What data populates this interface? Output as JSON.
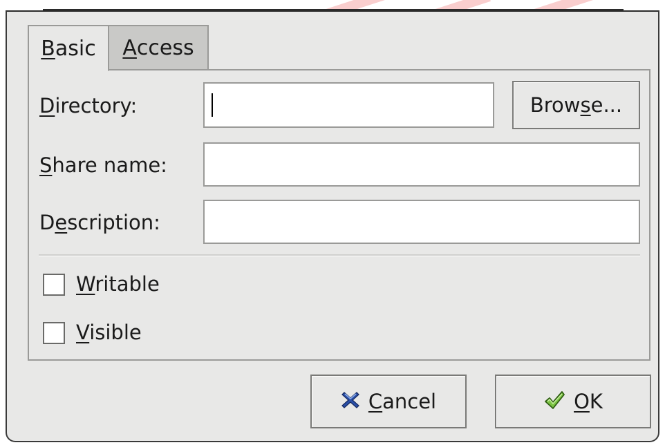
{
  "dialog": {
    "tabs": [
      {
        "mnemonic": "B",
        "rest": "asic"
      },
      {
        "mnemonic": "A",
        "rest": "ccess"
      }
    ],
    "fields": {
      "directory": {
        "label_pre": "",
        "mnemonic": "D",
        "label_post": "irectory:",
        "value": ""
      },
      "share_name": {
        "label_pre": "",
        "mnemonic": "S",
        "label_post": "hare name:",
        "value": ""
      },
      "description": {
        "label_pre": "D",
        "mnemonic": "e",
        "label_post": "scription:",
        "value": ""
      }
    },
    "browse": {
      "pre": "Brow",
      "mnemonic": "s",
      "post": "e..."
    },
    "checkboxes": {
      "writable": {
        "mnemonic": "W",
        "rest": "ritable",
        "checked": false
      },
      "visible": {
        "mnemonic": "V",
        "rest": "isible",
        "checked": false
      }
    },
    "buttons": {
      "cancel": {
        "mnemonic": "C",
        "rest": "ancel",
        "icon": "cancel-x-icon"
      },
      "ok": {
        "mnemonic": "O",
        "rest": "K",
        "icon": "checkmark-icon"
      }
    }
  },
  "colors": {
    "dialog_bg": "#e8e8e7",
    "inactive_tab_bg": "#c9c9c7",
    "border": "#9a9a98",
    "cancel_icon_blue": "#2a4fa8",
    "ok_icon_green": "#5aa02c"
  }
}
